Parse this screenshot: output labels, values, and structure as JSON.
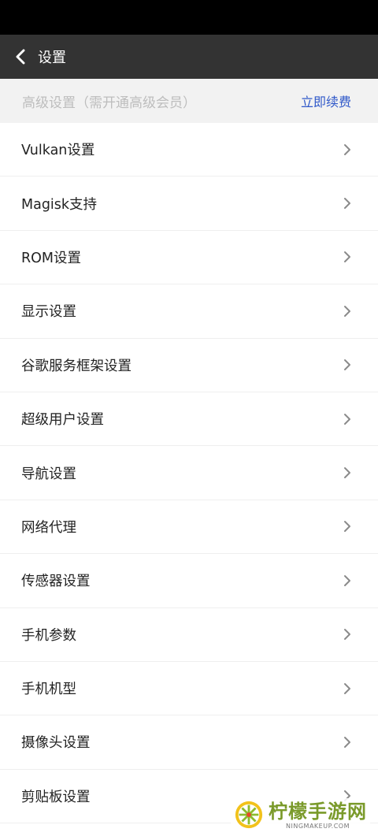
{
  "header": {
    "title": "设置",
    "back_icon": "chevron-left-icon"
  },
  "premium": {
    "label": "高级设置（需开通高级会员）",
    "action": "立即续费",
    "action_color": "#2f58c9"
  },
  "settings": {
    "items": [
      {
        "label": "Vulkan设置"
      },
      {
        "label": "Magisk支持"
      },
      {
        "label": "ROM设置"
      },
      {
        "label": "显示设置"
      },
      {
        "label": "谷歌服务框架设置"
      },
      {
        "label": "超级用户设置"
      },
      {
        "label": "导航设置"
      },
      {
        "label": "网络代理"
      },
      {
        "label": "传感器设置"
      },
      {
        "label": "手机参数"
      },
      {
        "label": "手机机型"
      },
      {
        "label": "摄像头设置"
      },
      {
        "label": "剪贴板设置"
      }
    ]
  },
  "watermark": {
    "name": "柠檬手游网",
    "domain": "NINGMAKEUP.COM"
  },
  "colors": {
    "app_bar": "#333333",
    "status_bar": "#000000",
    "premium_bg": "#f2f2f2"
  }
}
